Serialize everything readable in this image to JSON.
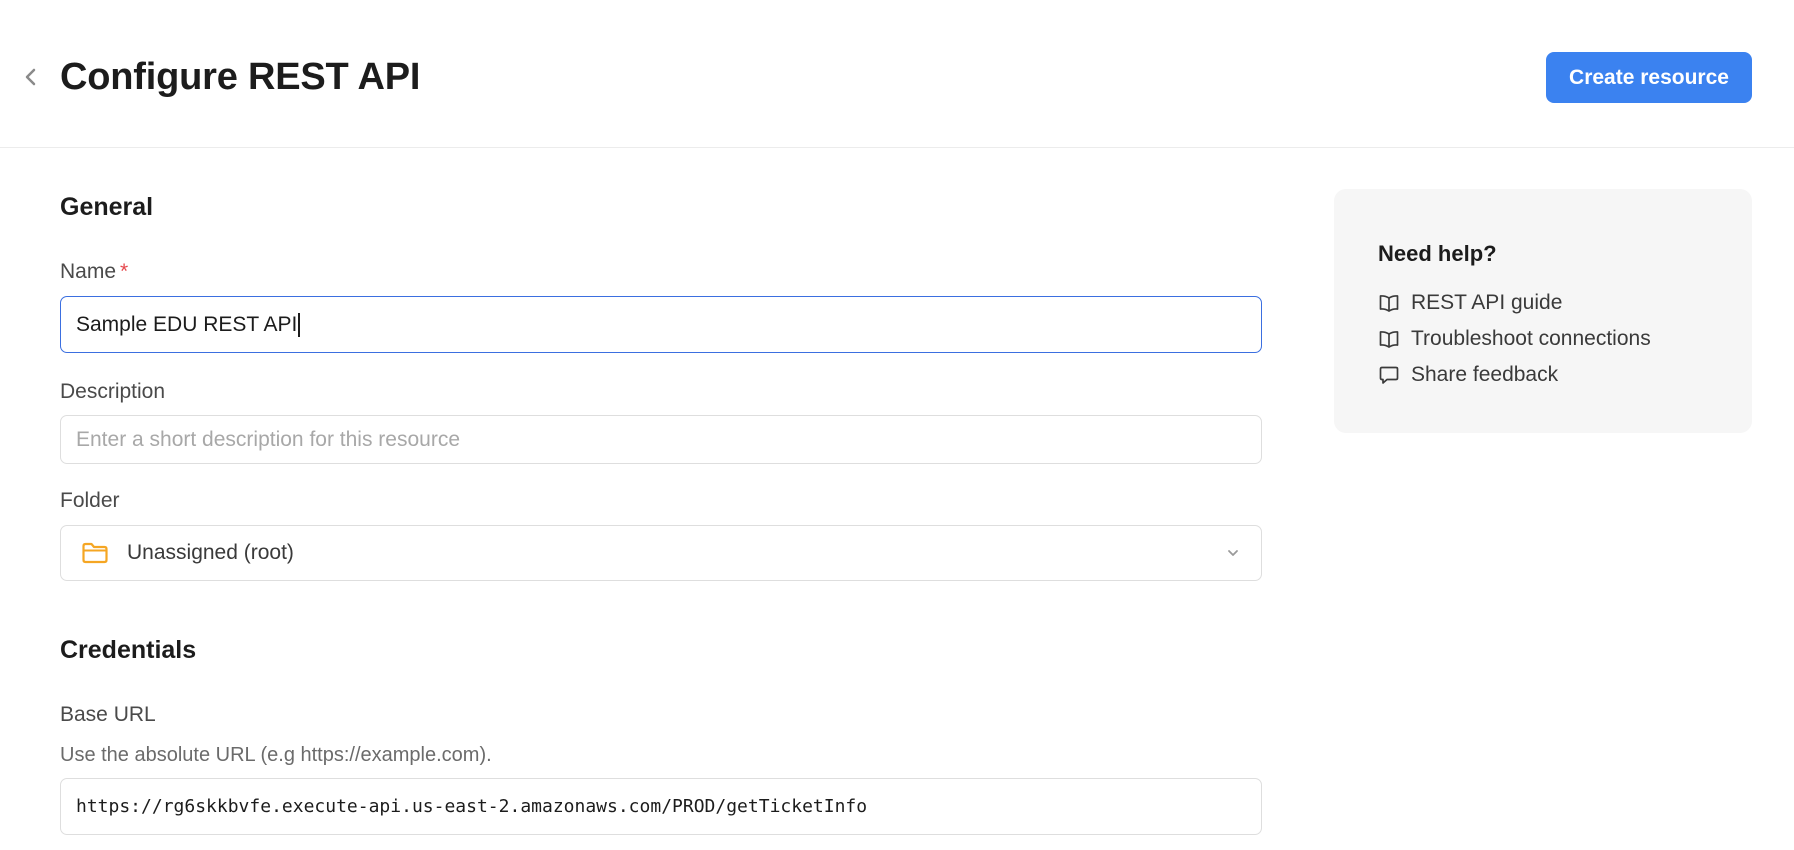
{
  "header": {
    "title": "Configure REST API",
    "create_button": "Create resource",
    "back_icon": "chevron-left-icon"
  },
  "general": {
    "heading": "General",
    "name": {
      "label": "Name",
      "required": "*",
      "value": "Sample EDU REST API"
    },
    "description": {
      "label": "Description",
      "value": "",
      "placeholder": "Enter a short description for this resource"
    },
    "folder": {
      "label": "Folder",
      "value": "Unassigned (root)",
      "icon": "folder-icon",
      "icon_color": "#f5a623"
    }
  },
  "credentials": {
    "heading": "Credentials",
    "base_url": {
      "label": "Base URL",
      "hint": "Use the absolute URL (e.g https://example.com).",
      "value": "https://rg6skkbvfe.execute-api.us-east-2.amazonaws.com/PROD/getTicketInfo"
    }
  },
  "help": {
    "title": "Need help?",
    "links": [
      {
        "label": "REST API guide",
        "icon": "book-open-icon"
      },
      {
        "label": "Troubleshoot connections",
        "icon": "book-open-icon"
      },
      {
        "label": "Share feedback",
        "icon": "chat-bubble-icon"
      }
    ]
  },
  "colors": {
    "accent": "#3b82f0",
    "focus_border": "#3b6fe0",
    "required": "#e5484d"
  }
}
